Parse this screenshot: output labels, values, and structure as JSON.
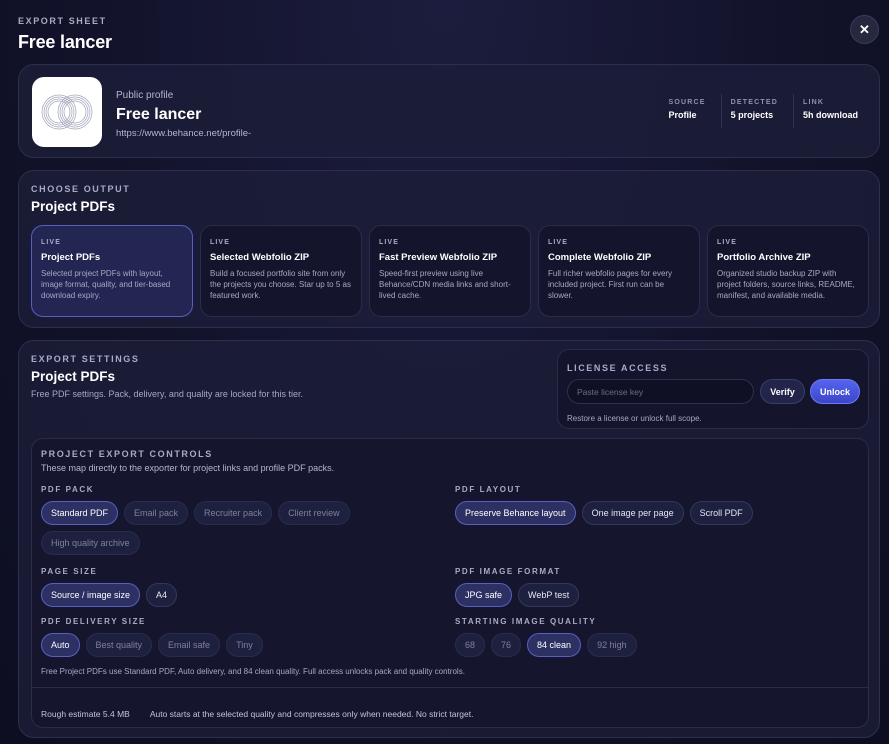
{
  "header": {
    "eyebrow": "EXPORT SHEET",
    "title": "Free lancer",
    "close_label": "✕"
  },
  "profile": {
    "kicker": "Public profile",
    "name": "Free lancer",
    "url": "https://www.behance.net/profile-",
    "stats": [
      {
        "label": "SOURCE",
        "value": "Profile"
      },
      {
        "label": "DETECTED",
        "value": "5 projects"
      },
      {
        "label": "LINK",
        "value": "5h download"
      }
    ]
  },
  "output": {
    "eyebrow": "CHOOSE OUTPUT",
    "title": "Project PDFs",
    "options": [
      {
        "tag": "LIVE",
        "title": "Project PDFs",
        "desc": "Selected project PDFs with layout, image format, quality, and tier-based download expiry.",
        "selected": true
      },
      {
        "tag": "LIVE",
        "title": "Selected Webfolio ZIP",
        "desc": "Build a focused portfolio site from only the projects you choose. Star up to 5 as featured work.",
        "selected": false
      },
      {
        "tag": "LIVE",
        "title": "Fast Preview Webfolio ZIP",
        "desc": "Speed-first preview using live Behance/CDN media links and short-lived cache.",
        "selected": false
      },
      {
        "tag": "LIVE",
        "title": "Complete Webfolio ZIP",
        "desc": "Full richer webfolio pages for every included project. First run can be slower.",
        "selected": false
      },
      {
        "tag": "LIVE",
        "title": "Portfolio Archive ZIP",
        "desc": "Organized studio backup ZIP with project folders, source links, README, manifest, and available media.",
        "selected": false
      }
    ]
  },
  "settings": {
    "eyebrow": "EXPORT SETTINGS",
    "title": "Project PDFs",
    "sub": "Free PDF settings. Pack, delivery, and quality are locked for this tier.",
    "license": {
      "eyebrow": "LICENSE ACCESS",
      "placeholder": "Paste license key",
      "verify_label": "Verify",
      "unlock_label": "Unlock",
      "hint": "Restore a license or unlock full scope."
    },
    "controls": {
      "eyebrow": "PROJECT EXPORT CONTROLS",
      "sub": "These map directly to the exporter for project links and profile PDF packs.",
      "pdf_pack": {
        "label": "PDF PACK",
        "options": [
          "Standard PDF",
          "Email pack",
          "Recruiter pack",
          "Client review",
          "High quality archive"
        ]
      },
      "pdf_layout": {
        "label": "PDF LAYOUT",
        "options": [
          "Preserve Behance layout",
          "One image per page",
          "Scroll PDF"
        ]
      },
      "page_size": {
        "label": "PAGE SIZE",
        "options": [
          "Source / image size",
          "A4"
        ]
      },
      "image_format": {
        "label": "PDF IMAGE FORMAT",
        "options": [
          "JPG safe",
          "WebP test"
        ]
      },
      "delivery_size": {
        "label": "PDF DELIVERY SIZE",
        "options": [
          "Auto",
          "Best quality",
          "Email safe",
          "Tiny"
        ]
      },
      "image_quality": {
        "label": "STARTING IMAGE QUALITY",
        "options": [
          "68",
          "76",
          "84 clean",
          "92 high"
        ]
      },
      "note": "Free Project PDFs use Standard PDF, Auto delivery, and 84 clean quality. Full access unlocks pack and quality controls.",
      "estimate": "Rough estimate 5.4 MB",
      "estimate_note": "Auto starts at the selected quality and compresses only when needed. No strict target."
    }
  }
}
